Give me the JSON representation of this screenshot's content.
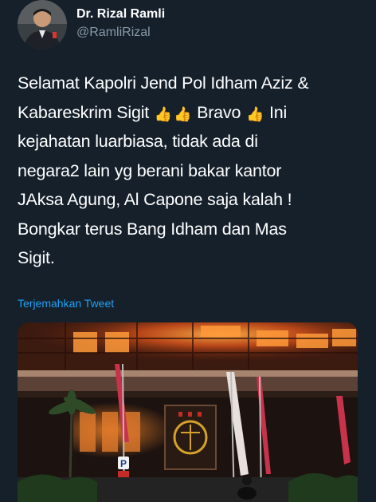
{
  "user": {
    "display_name": "Dr. Rizal Ramli",
    "handle": "@RamliRizal"
  },
  "tweet": {
    "lines": [
      "Selamat Kapolri Jend Pol Idham Aziz &",
      "Kabareskrim Sigit",
      "Bravo",
      "Ini",
      "kejahatan luarbiasa, tidak ada di",
      "negara2 lain yg berani bakar kantor",
      "JAksa Agung, Al Capone saja kalah !",
      "Bongkar terus Bang Idham dan Mas",
      "Sigit."
    ],
    "emoji": "👍"
  },
  "translate_label": "Terjemahkan Tweet",
  "media": {
    "sign_letter": "P"
  },
  "colors": {
    "background": "#15202b",
    "text": "#ffffff",
    "secondary": "#8899a6",
    "link": "#1da1f2"
  }
}
